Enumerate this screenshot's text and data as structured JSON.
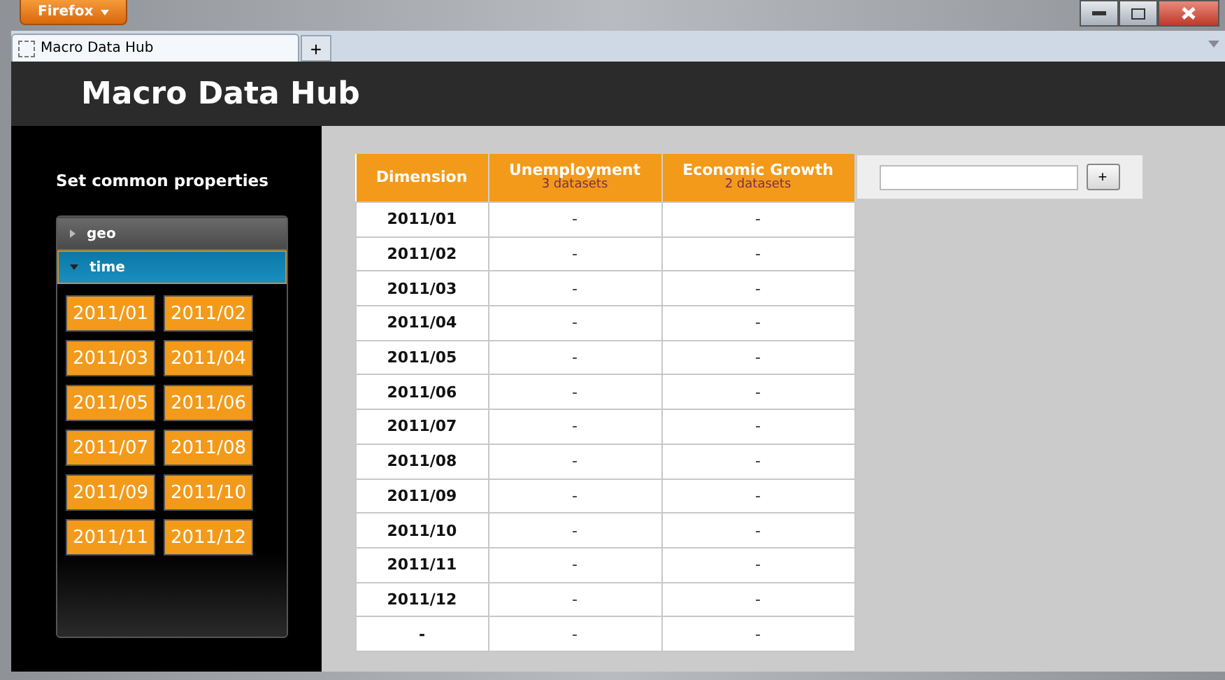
{
  "browser": {
    "menu_button": "Firefox",
    "tab": {
      "title": "Macro Data Hub"
    },
    "new_tab": "+"
  },
  "header": {
    "title": "Macro Data Hub"
  },
  "sidebar": {
    "title": "Set common properties",
    "sections": [
      {
        "label": "geo",
        "expanded": false
      },
      {
        "label": "time",
        "expanded": true,
        "items": [
          "2011/01",
          "2011/02",
          "2011/03",
          "2011/04",
          "2011/05",
          "2011/06",
          "2011/07",
          "2011/08",
          "2011/09",
          "2011/10",
          "2011/11",
          "2011/12"
        ]
      }
    ]
  },
  "table": {
    "columns": [
      {
        "title": "Dimension"
      },
      {
        "title": "Unemployment",
        "subtitle": "3 datasets"
      },
      {
        "title": "Economic Growth",
        "subtitle": "2 datasets"
      }
    ],
    "rows": [
      [
        "2011/01",
        "-",
        "-"
      ],
      [
        "2011/02",
        "-",
        "-"
      ],
      [
        "2011/03",
        "-",
        "-"
      ],
      [
        "2011/04",
        "-",
        "-"
      ],
      [
        "2011/05",
        "-",
        "-"
      ],
      [
        "2011/06",
        "-",
        "-"
      ],
      [
        "2011/07",
        "-",
        "-"
      ],
      [
        "2011/08",
        "-",
        "-"
      ],
      [
        "2011/09",
        "-",
        "-"
      ],
      [
        "2011/10",
        "-",
        "-"
      ],
      [
        "2011/11",
        "-",
        "-"
      ],
      [
        "2011/12",
        "-",
        "-"
      ],
      [
        "-",
        "-",
        "-"
      ]
    ]
  },
  "add_column": {
    "button": "+"
  }
}
